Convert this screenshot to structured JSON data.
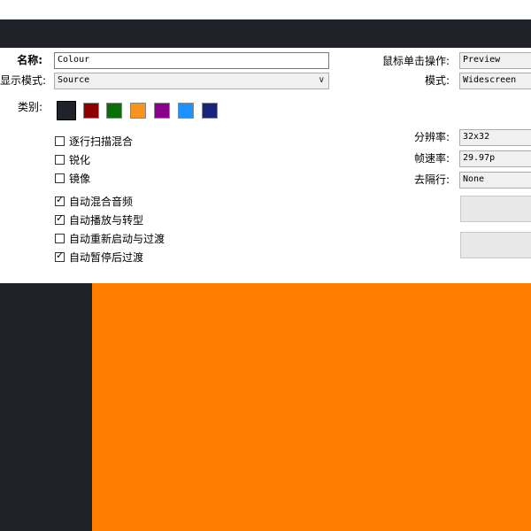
{
  "form": {
    "name_label": "名称:",
    "name_value": "Colour",
    "display_mode_label": "显示模式:",
    "display_mode_value": "Source",
    "category_label": "类别:",
    "mouse_click_label": "鼠标单击操作:",
    "mouse_click_value": "Preview",
    "mode_label": "模式:",
    "mode_value": "Widescreen",
    "resolution_label": "分辨率:",
    "resolution_value": "32x32",
    "framerate_label": "帧速率:",
    "framerate_value": "29.97p",
    "deinterlace_label": "去隔行:",
    "deinterlace_value": "None"
  },
  "swatches": {
    "colors": [
      "#1f2329",
      "#8b0000",
      "#0a6e0a",
      "#f7931e",
      "#8b008b",
      "#1e90ff",
      "#1a237e"
    ]
  },
  "checkboxes": {
    "items": [
      {
        "label": "逐行扫描混合",
        "checked": false
      },
      {
        "label": "锐化",
        "checked": false
      },
      {
        "label": "镜像",
        "checked": false
      },
      {
        "label": "自动混合音频",
        "checked": true
      },
      {
        "label": "自动播放与转型",
        "checked": true
      },
      {
        "label": "自动重新启动与过渡",
        "checked": false
      },
      {
        "label": "自动暂停后过渡",
        "checked": true
      }
    ],
    "check_glyph": "✓"
  },
  "icons": {
    "combo_arrow": "chevron-down-icon",
    "check": "check-icon"
  },
  "colors": {
    "titlebar": "#1f2329",
    "preview_bg": "#1f2329",
    "preview_colour": "#ff8000"
  }
}
